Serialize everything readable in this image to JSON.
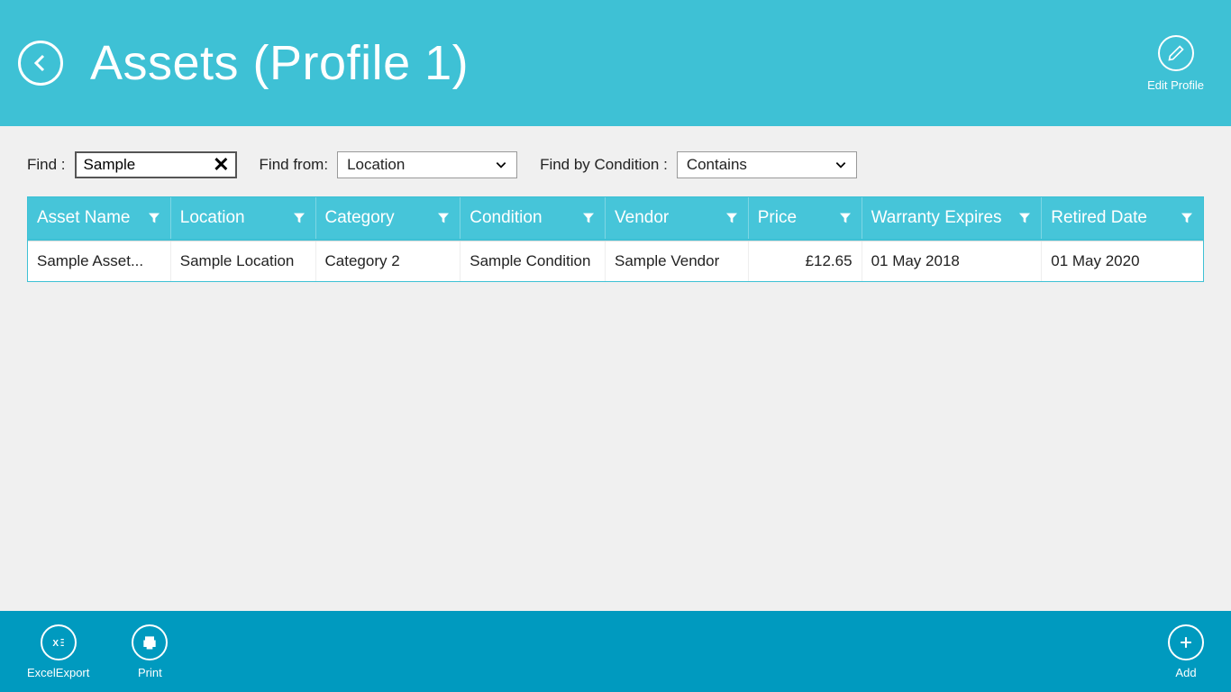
{
  "header": {
    "title": "Assets (Profile 1)",
    "edit_profile_label": "Edit Profile"
  },
  "filters": {
    "find_label": "Find :",
    "find_value": "Sample",
    "find_from_label": "Find from:",
    "find_from_value": "Location",
    "find_condition_label": "Find by Condition :",
    "find_condition_value": "Contains"
  },
  "table": {
    "columns": [
      {
        "label": "Asset Name"
      },
      {
        "label": "Location"
      },
      {
        "label": "Category"
      },
      {
        "label": "Condition"
      },
      {
        "label": "Vendor"
      },
      {
        "label": "Price"
      },
      {
        "label": "Warranty Expires"
      },
      {
        "label": "Retired Date"
      }
    ],
    "rows": [
      {
        "asset_name": "Sample Asset...",
        "location": "Sample Location",
        "category": "Category 2",
        "condition": "Sample Condition",
        "vendor": "Sample Vendor",
        "price": "£12.65",
        "warranty_expires": "01 May 2018",
        "retired_date": "01 May 2020"
      }
    ]
  },
  "appbar": {
    "excel_export": "ExcelExport",
    "print": "Print",
    "add": "Add"
  }
}
